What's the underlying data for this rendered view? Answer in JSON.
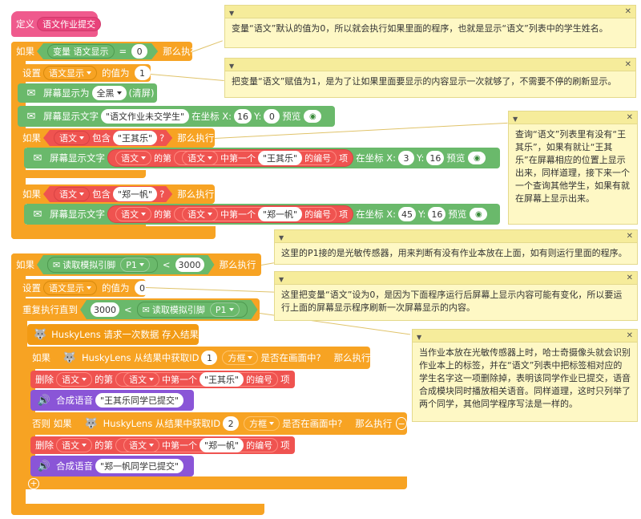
{
  "define_block": {
    "keyword": "定义",
    "name": "语文作业提交"
  },
  "if1": {
    "keyword": "如果",
    "var": "变量 语文显示",
    "eq": "=",
    "value": "0",
    "then": "那么执行"
  },
  "set1": {
    "keyword": "设置",
    "var": "语文显示",
    "value_label": "的值为",
    "value": "1"
  },
  "screen_show": {
    "label": "屏幕显示为",
    "color": "全黑",
    "suffix": "(清屏)"
  },
  "screen_text1": {
    "label": "屏幕显示文字",
    "text": "\"语文作业未交学生\"",
    "at": "在坐标 X:",
    "x": "16",
    "y_label": "Y:",
    "y": "0",
    "preview": "预览"
  },
  "if2": {
    "keyword": "如果",
    "list": "语文",
    "contains": "包含",
    "item": "\"王其乐\"",
    "q": "?",
    "then": "那么执行"
  },
  "screen_text2": {
    "label": "屏幕显示文字",
    "list": "语文",
    "of": "的第",
    "list2": "语文",
    "first": "中第一个",
    "item": "\"王其乐\"",
    "index": "的编号",
    "term": "项",
    "at": "在坐标 X:",
    "x": "3",
    "y_label": "Y:",
    "y": "16",
    "preview": "预览"
  },
  "if3": {
    "keyword": "如果",
    "list": "语文",
    "contains": "包含",
    "item": "\"郑一帆\"",
    "q": "?",
    "then": "那么执行"
  },
  "screen_text3": {
    "label": "屏幕显示文字",
    "list": "语文",
    "of": "的第",
    "list2": "语文",
    "first": "中第一个",
    "item": "\"郑一帆\"",
    "index": "的编号",
    "term": "项",
    "at": "在坐标 X:",
    "x": "45",
    "y_label": "Y:",
    "y": "16",
    "preview": "预览"
  },
  "if4": {
    "keyword": "如果",
    "read": "读取模拟引脚",
    "pin": "P1",
    "lt": "<",
    "value": "3000",
    "then": "那么执行"
  },
  "set2": {
    "keyword": "设置",
    "var": "语文显示",
    "value_label": "的值为",
    "value": "0"
  },
  "repeat": {
    "keyword": "重复执行直到",
    "value": "3000",
    "lt": "<",
    "read": "读取模拟引脚",
    "pin": "P1"
  },
  "husky_request": {
    "label": "HuskyLens 请求一次数据 存入结果"
  },
  "if5": {
    "keyword": "如果",
    "label": "HuskyLens 从结果中获取ID",
    "id": "1",
    "box": "方框",
    "q": "是否在画面中?",
    "then": "那么执行"
  },
  "delete1": {
    "keyword": "删除",
    "list": "语文",
    "of": "的第",
    "list2": "语文",
    "first": "中第一个",
    "item": "\"王其乐\"",
    "index": "的编号",
    "term": "项"
  },
  "speech1": {
    "label": "合成语音",
    "text": "\"王其乐同学已提交\""
  },
  "elseif": {
    "keyword": "否则 如果",
    "label": "HuskyLens 从结果中获取ID",
    "id": "2",
    "box": "方框",
    "q": "是否在画面中?",
    "then": "那么执行"
  },
  "delete2": {
    "keyword": "删除",
    "list": "语文",
    "of": "的第",
    "list2": "语文",
    "first": "中第一个",
    "item": "\"郑一帆\"",
    "index": "的编号",
    "term": "项"
  },
  "speech2": {
    "label": "合成语音",
    "text": "\"郑一帆同学已提交\""
  },
  "comments": {
    "c1": "变量“语文”默认的值为0，所以就会执行如果里面的程序，也就是显示“语文”列表中的学生姓名。",
    "c2": "把变量“语文”赋值为1，是为了让如果里面要显示的内容显示一次就够了，不需要不停的刷新显示。",
    "c3": "查询“语文”列表里有没有“王其乐”，如果有就让“王其乐”在屏幕相应的位置上显示出来，同样道理，接下来一个一个查询其他学生，如果有就在屏幕上显示出来。",
    "c4": "这里的P1接的是光敏传感器，用来判断有没有作业本放在上面，如有则运行里面的程序。",
    "c5": "这里把变量“语文”设为0，是因为下面程序运行后屏幕上显示内容可能有变化，所以要运行上面的屏幕显示程序刷新一次屏幕显示的内容。",
    "c6": "当作业本放在光敏传感器上时，哈士奇摄像头就会识别作业本上的标签，并在“语文”列表中把标签相对应的学生名字这一项删除掉，表明该同学作业已提交，语音合成模块同时播放相关语音。同样道理，这时只列举了两个同学，其他同学程序写法是一样的。"
  },
  "colors": {
    "define": "#ef5a8d",
    "control": "#f7a323",
    "display": "#6ab96b",
    "list": "#ef5350",
    "speech": "#8a55d7",
    "comment": "#fef8c5"
  }
}
